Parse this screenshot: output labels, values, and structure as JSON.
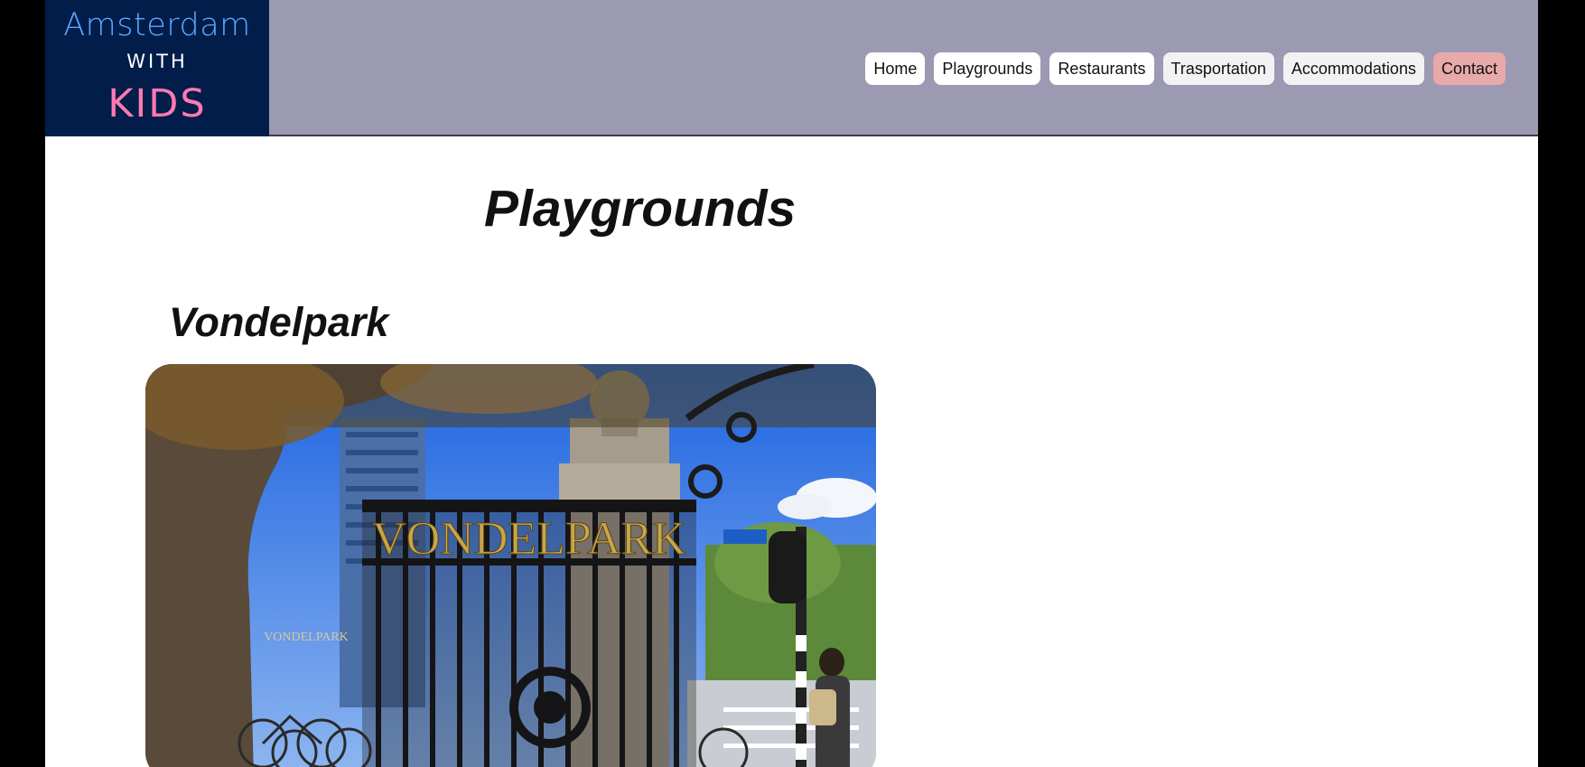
{
  "logo": {
    "line1": "Amsterdam",
    "line2": "WITH",
    "line3": "KIDS"
  },
  "nav": [
    {
      "label": "Home"
    },
    {
      "label": "Playgrounds"
    },
    {
      "label": "Restaurants"
    },
    {
      "label": "Trasportation"
    },
    {
      "label": "Accommodations"
    },
    {
      "label": "Contact"
    }
  ],
  "main": {
    "title": "Playgrounds",
    "section_title": "Vondelpark",
    "photo_sign": "VONDELPARK",
    "photo_sign_small": "VONDELPARK"
  },
  "colors": {
    "header_bg": "#9c9ab2",
    "logo_bg": "#031d4a",
    "contact_bg": "#e7a9a9"
  }
}
